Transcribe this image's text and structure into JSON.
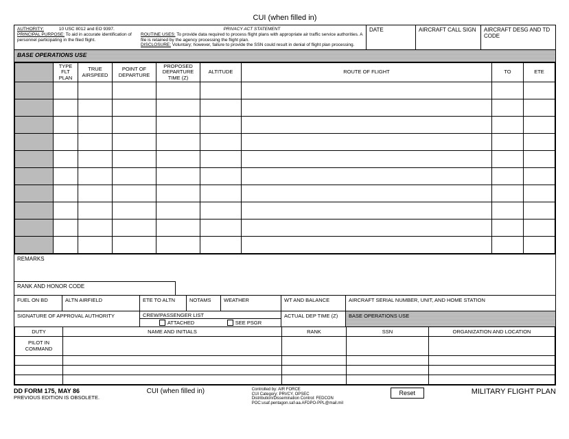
{
  "title_top": "CUI (when filled in)",
  "privacy": {
    "heading": "PRIVACY ACT STATEMENT",
    "authority_label": "AUTHORITY:",
    "authority_text": "10 USC 8012 and EO 9397.",
    "principal_label": "PRINCIPAL PURPOSE:",
    "principal_text": "To aid in accurate identification of personnel participating in the filed flight.",
    "routine_label": "ROUTINE USES:",
    "routine_text": "To provide data required to process flight plans with appropriate air traffic service authorities.  A file is retained by the agency processing the flight plan.",
    "disclosure_label": "DISCLOSURE:",
    "disclosure_text": "Voluntary; however, failure to provide the SSN could result in denial of flight plan processing."
  },
  "header": {
    "date": "DATE",
    "callsign": "AIRCRAFT CALL SIGN",
    "desg": "AIRCRAFT DESG AND TD CODE"
  },
  "base_ops_label": "BASE OPERATIONS USE",
  "flight_cols": {
    "c0": "",
    "type_flt": "TYPE FLT PLAN",
    "airspeed": "TRUE AIRSPEED",
    "point_dep": "POINT OF DEPARTURE",
    "prop_dep": "PROPOSED DEPARTURE TIME (Z)",
    "altitude": "ALTITUDE",
    "route": "ROUTE OF FLIGHT",
    "to": "TO",
    "ete": "ETE"
  },
  "remarks_label": "REMARKS",
  "rank_honor": "RANK AND HONOR CODE",
  "row_a": {
    "fuel": "FUEL ON BD",
    "altn": "ALTN AIRFIELD",
    "ete_altn": "ETE TO ALTN",
    "notams": "NOTAMS",
    "weather": "WEATHER",
    "wtbal": "WT AND BALANCE",
    "serial": "AIRCRAFT SERIAL NUMBER, UNIT, AND HOME STATION"
  },
  "row_b": {
    "sig": "SIGNATURE OF APPROVAL AUTHORITY",
    "crewlist": "CREW/PASSENGER LIST",
    "attached": "ATTACHED",
    "seepsgr": "SEE PSGR",
    "actual_dep": "ACTUAL DEP TIME (Z)",
    "baseops": "BASE OPERATIONS USE"
  },
  "piccrew": {
    "duty": "DUTY",
    "name": "NAME AND INITIALS",
    "rank": "RANK",
    "ssn": "SSN",
    "org": "ORGANIZATION AND LOCATION",
    "pic": "PILOT IN COMMAND"
  },
  "footer": {
    "form_id": "DD FORM 175, MAY 86",
    "obsolete": "PREVIOUS EDITION IS OBSOLETE.",
    "cui": "CUI (when filled in)",
    "ctrl1": "Controlled by: AIR FORCE",
    "ctrl2": "CUI Category: PRVCY, OPSEC",
    "ctrl3": "Distribution/Dissemination Control: FEDCON",
    "ctrl4": "POC:usaf.pentagon.saf-aa.AFDPO-PPL@mail.mil",
    "reset": "Reset",
    "title": "MILITARY FLIGHT PLAN"
  }
}
